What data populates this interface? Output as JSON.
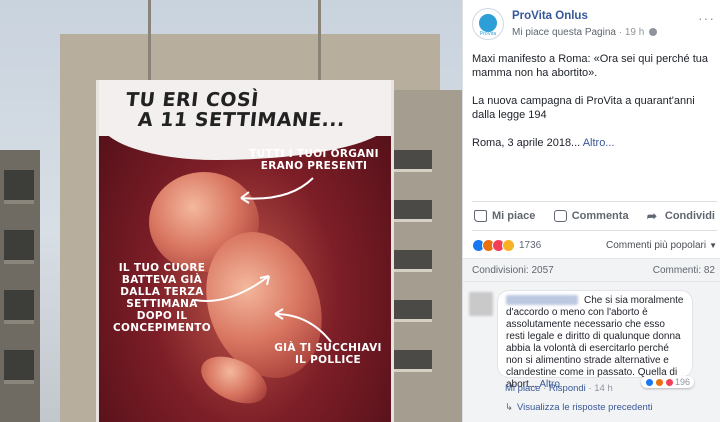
{
  "photo": {
    "banner_title_line1": "TU ERI COSÌ",
    "banner_title_line2": "A 11 SETTIMANE...",
    "callout_organs_line1": "TUTTI I TUOI ORGANI",
    "callout_organs_line2": "ERANO PRESENTI",
    "callout_heart_line1": "IL TUO CUORE",
    "callout_heart_line2": "BATTEVA GIÀ",
    "callout_heart_line3": "DALLA TERZA",
    "callout_heart_line4": "SETTIMANA",
    "callout_heart_line5": "DOPO IL",
    "callout_heart_line6": "CONCEPIMENTO",
    "callout_thumb_line1": "GIÀ TI SUCCHIAVI",
    "callout_thumb_line2": "IL POLLICE"
  },
  "post": {
    "page_name": "ProVita Onlus",
    "avatar_caption": "ProVita",
    "like_page": "Mi piace questa Pagina",
    "separator": "·",
    "time": "19 h",
    "more_options": "···",
    "text_p1": "Maxi manifesto a Roma: «Ora sei qui perché tua mamma non ha abortito».",
    "text_p2": "La nuova campagna di ProVita a quarant'anni dalla legge 194",
    "text_p3": "Roma, 3 aprile 2018...",
    "see_more": "Altro..."
  },
  "actions": {
    "like": "Mi piace",
    "comment": "Commenta",
    "share": "Condividi"
  },
  "reactions": {
    "count": "1736",
    "sort_label": "Commenti più popolari"
  },
  "counts": {
    "shares": "Condivisioni: 2057",
    "comments": "Commenti: 82"
  },
  "comment": {
    "text": "Che si sia moralmente d'accordo o meno con l'aborto è assolutamente necessario che esso resti legale e diritto di qualunque donna abbia la volontà di esercitarlo perché non si alimentino strade alternative e clandestine come in passato. Quella di abort...",
    "see_more": "Altro",
    "reaction_count": "196",
    "like": "Mi piace",
    "reply": "Rispondi",
    "time": "14 h",
    "view_replies": "Visualizza le risposte precedenti"
  },
  "colors": {
    "fb_blue": "#365899",
    "link_blue": "#385898",
    "banner_red": "#7d1e27",
    "like_blue": "#1877f2"
  }
}
